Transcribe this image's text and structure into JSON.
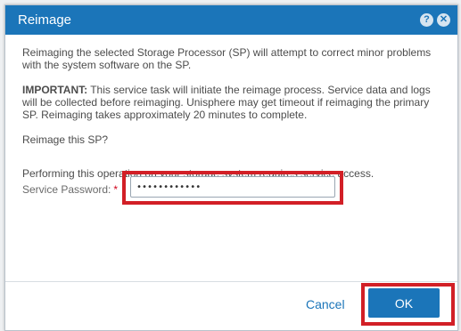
{
  "dialog": {
    "title": "Reimage",
    "help_icon": "help-icon",
    "close_icon": "close-icon"
  },
  "body": {
    "intro": "Reimaging the selected Storage Processor (SP) will attempt to correct minor problems with the system software on the SP.",
    "important_label": "IMPORTANT:",
    "important_text": " This service task will initiate the reimage process. Service data and logs will be collected before reimaging. Unisphere may get timeout if reimaging the primary SP. Reimaging takes approximately 20 minutes to complete.",
    "question": "Reimage this SP?",
    "access_note": "Performing this operation on your storage system requires service access.",
    "password_label": "Service Password:",
    "required_marker": "*",
    "password_value": "••••••••••••"
  },
  "footer": {
    "cancel_label": "Cancel",
    "ok_label": "OK"
  },
  "colors": {
    "title_bar": "#1b75b9",
    "highlight": "#d21f26",
    "link": "#1b75b9"
  }
}
